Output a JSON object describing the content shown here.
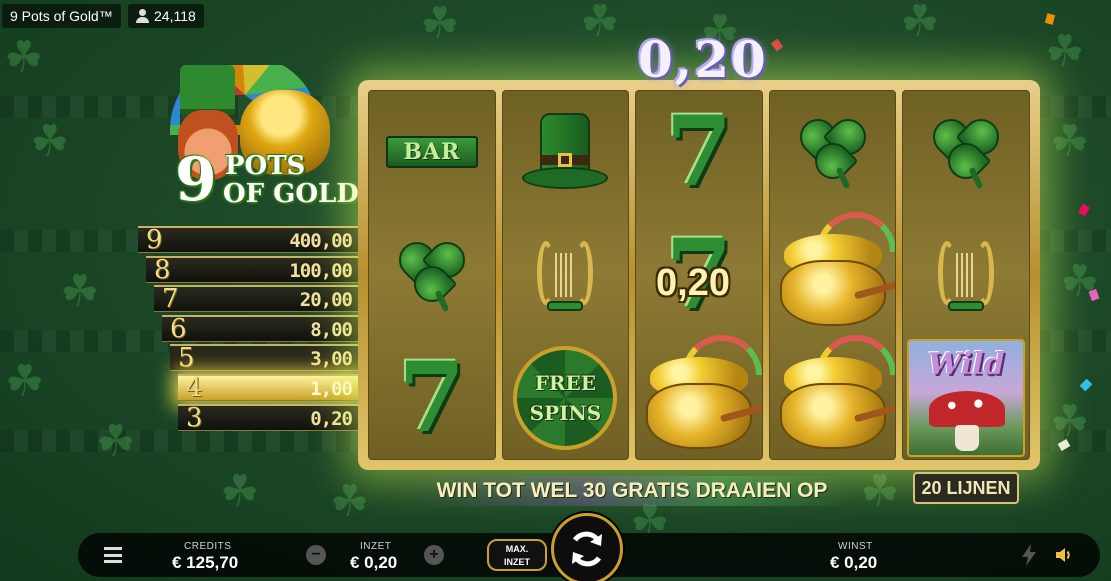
{
  "topbar": {
    "game_title": "9 Pots of Gold™",
    "player_count": "24,118"
  },
  "logo": {
    "number": "9",
    "line1": "POTS",
    "line2": "OF GOLD"
  },
  "paytable": [
    {
      "count": "9",
      "value": "400,00"
    },
    {
      "count": "8",
      "value": "100,00"
    },
    {
      "count": "7",
      "value": "20,00"
    },
    {
      "count": "6",
      "value": "8,00"
    },
    {
      "count": "5",
      "value": "3,00"
    },
    {
      "count": "4",
      "value": "1,00"
    },
    {
      "count": "3",
      "value": "0,20"
    }
  ],
  "reels": [
    [
      "bar",
      "clover",
      "seven"
    ],
    [
      "hat",
      "lyre",
      "free-spins"
    ],
    [
      "seven",
      "seven",
      "pot-of-gold"
    ],
    [
      "clover",
      "pot-of-gold",
      "pot-of-gold"
    ],
    [
      "clover",
      "lyre",
      "wild"
    ]
  ],
  "symbols": {
    "bar_label": "BAR",
    "seven_label": "7",
    "free_line1": "FREE",
    "free_line2": "SPINS",
    "wild_label": "Wild"
  },
  "win": {
    "total": "0,20",
    "line_win": "0,20"
  },
  "marquee": "WIN TOT WEL 30 GRATIS DRAAIEN OP",
  "lines_badge": "20 LIJNEN",
  "bottom_bar": {
    "credits_label": "CREDITS",
    "credits_value": "€ 125,70",
    "bet_label": "INZET",
    "bet_value": "€ 0,20",
    "max_bet_line1": "MAX.",
    "max_bet_line2": "INZET",
    "win_label": "WINST",
    "win_value": "€ 0,20",
    "minus": "−",
    "plus": "+"
  },
  "icons": [
    "menu-icon",
    "spin-icon",
    "turbo-icon",
    "sound-icon",
    "user-icon"
  ],
  "colors": {
    "accent_gold": "#c9a128",
    "reel_green": "#2e8c33"
  }
}
